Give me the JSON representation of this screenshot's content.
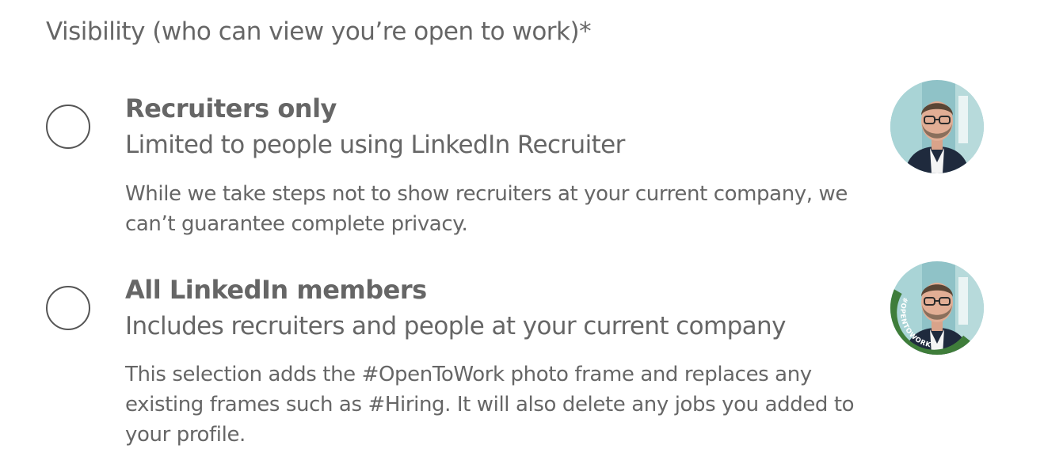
{
  "visibility": {
    "heading": "Visibility (who can view you’re open to work)*",
    "options": [
      {
        "title": "Recruiters only",
        "subtitle": "Limited to people using LinkedIn Recruiter",
        "description": "While we take steps not to show recruiters at your current company, we can’t guarantee complete privacy.",
        "selected": false,
        "avatar_frame": "none"
      },
      {
        "title": "All LinkedIn members",
        "subtitle": "Includes recruiters and people at your current company",
        "description": "This selection adds the #OpenToWork photo frame and replaces any existing frames such as #Hiring. It will also delete any jobs you added to your profile.",
        "selected": false,
        "avatar_frame": "opentowork",
        "frame_label": "#OPENTOWORK"
      }
    ]
  },
  "colors": {
    "text": "#666666",
    "radio_border": "#555555",
    "opentowork_green": "#3f7d3a",
    "avatar_bg": "#8fc2c7"
  },
  "icons": {
    "radio_unchecked": "radio-unchecked-icon",
    "profile_photo": "profile-photo-icon"
  }
}
